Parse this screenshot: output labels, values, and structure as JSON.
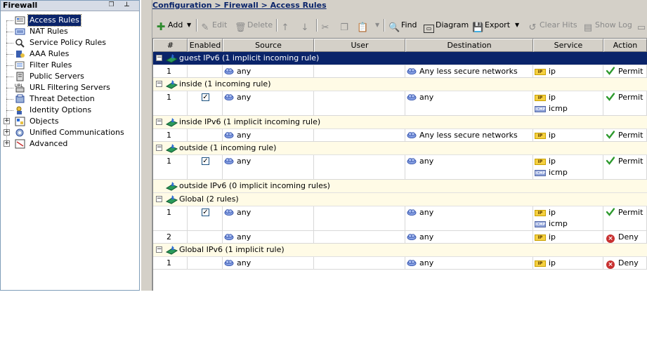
{
  "left_panel": {
    "title": "Firewall",
    "items": [
      {
        "label": "Access Rules",
        "icon": "access-rules-icon",
        "selected": true
      },
      {
        "label": "NAT Rules",
        "icon": "nat-rules-icon"
      },
      {
        "label": "Service Policy Rules",
        "icon": "service-policy-icon"
      },
      {
        "label": "AAA Rules",
        "icon": "aaa-rules-icon"
      },
      {
        "label": "Filter Rules",
        "icon": "filter-rules-icon"
      },
      {
        "label": "Public Servers",
        "icon": "public-servers-icon"
      },
      {
        "label": "URL Filtering Servers",
        "icon": "url-filtering-icon"
      },
      {
        "label": "Threat Detection",
        "icon": "threat-detection-icon"
      },
      {
        "label": "Identity Options",
        "icon": "identity-options-icon"
      },
      {
        "label": "Objects",
        "icon": "objects-icon",
        "expandable": true
      },
      {
        "label": "Unified Communications",
        "icon": "unified-communications-icon",
        "expandable": true
      },
      {
        "label": "Advanced",
        "icon": "advanced-icon",
        "expandable": true
      }
    ]
  },
  "breadcrumb": "Configuration > Firewall > Access Rules",
  "toolbar": {
    "add": "Add",
    "edit": "Edit",
    "delete": "Delete",
    "find": "Find",
    "diagram": "Diagram",
    "export": "Export",
    "clear_hits": "Clear Hits",
    "show_log": "Show Log"
  },
  "columns": [
    "#",
    "Enabled",
    "Source",
    "User",
    "Destination",
    "Service",
    "Action"
  ],
  "groups": [
    {
      "label": "guest IPv6 (1 implicit incoming rule)",
      "selected": true,
      "rows": [
        {
          "num": "1",
          "enabled": false,
          "source": "any",
          "user": "",
          "destination": "Any less secure networks",
          "services": [
            {
              "type": "ip",
              "name": "ip"
            }
          ],
          "action": "Permit"
        }
      ]
    },
    {
      "label": "inside (1 incoming rule)",
      "rows": [
        {
          "num": "1",
          "enabled": true,
          "source": "any",
          "user": "",
          "destination": "any",
          "services": [
            {
              "type": "ip",
              "name": "ip"
            },
            {
              "type": "icmp",
              "name": "icmp"
            }
          ],
          "action": "Permit"
        }
      ]
    },
    {
      "label": "inside IPv6 (1 implicit incoming rule)",
      "rows": [
        {
          "num": "1",
          "enabled": false,
          "source": "any",
          "user": "",
          "destination": "Any less secure networks",
          "services": [
            {
              "type": "ip",
              "name": "ip"
            }
          ],
          "action": "Permit"
        }
      ]
    },
    {
      "label": "outside (1 incoming rule)",
      "rows": [
        {
          "num": "1",
          "enabled": true,
          "source": "any",
          "user": "",
          "destination": "any",
          "services": [
            {
              "type": "ip",
              "name": "ip"
            },
            {
              "type": "icmp",
              "name": "icmp"
            }
          ],
          "action": "Permit"
        }
      ]
    },
    {
      "label": "outside IPv6 (0 implicit incoming rules)",
      "rows": []
    },
    {
      "label": "Global (2 rules)",
      "rows": [
        {
          "num": "1",
          "enabled": true,
          "source": "any",
          "user": "",
          "destination": "any",
          "services": [
            {
              "type": "ip",
              "name": "ip"
            },
            {
              "type": "icmp",
              "name": "icmp"
            }
          ],
          "action": "Permit"
        },
        {
          "num": "2",
          "enabled": false,
          "source": "any",
          "user": "",
          "destination": "any",
          "services": [
            {
              "type": "ip",
              "name": "ip"
            }
          ],
          "action": "Deny"
        }
      ]
    },
    {
      "label": "Global IPv6 (1 implicit rule)",
      "rows": [
        {
          "num": "1",
          "enabled": false,
          "source": "any",
          "user": "",
          "destination": "any",
          "services": [
            {
              "type": "ip",
              "name": "ip"
            }
          ],
          "action": "Deny"
        }
      ]
    }
  ],
  "colors": {
    "selection": "#0a246a",
    "group_bg": "#fffbe6",
    "panel_bg": "#d4d0c8",
    "permit": "#2e9a2e",
    "deny": "#c83030"
  }
}
